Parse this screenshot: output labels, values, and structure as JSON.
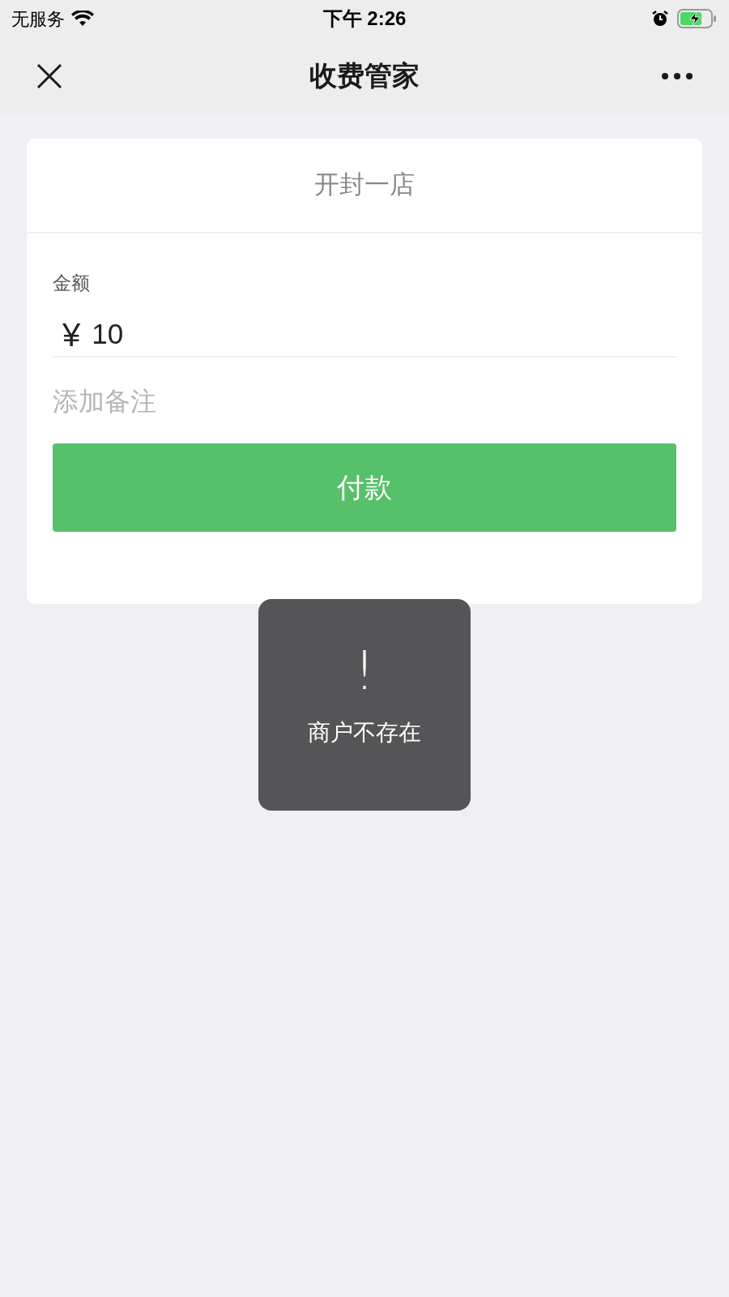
{
  "status_bar": {
    "carrier": "无服务",
    "time": "下午 2:26"
  },
  "nav": {
    "title": "收费管家"
  },
  "card": {
    "store_name": "开封一店",
    "amount_label": "金额",
    "currency": "¥",
    "amount": "10",
    "remark": {
      "placeholder": "添加备注"
    },
    "pay_button": "付款"
  },
  "toast": {
    "icon": "!",
    "message": "商户不存在"
  }
}
